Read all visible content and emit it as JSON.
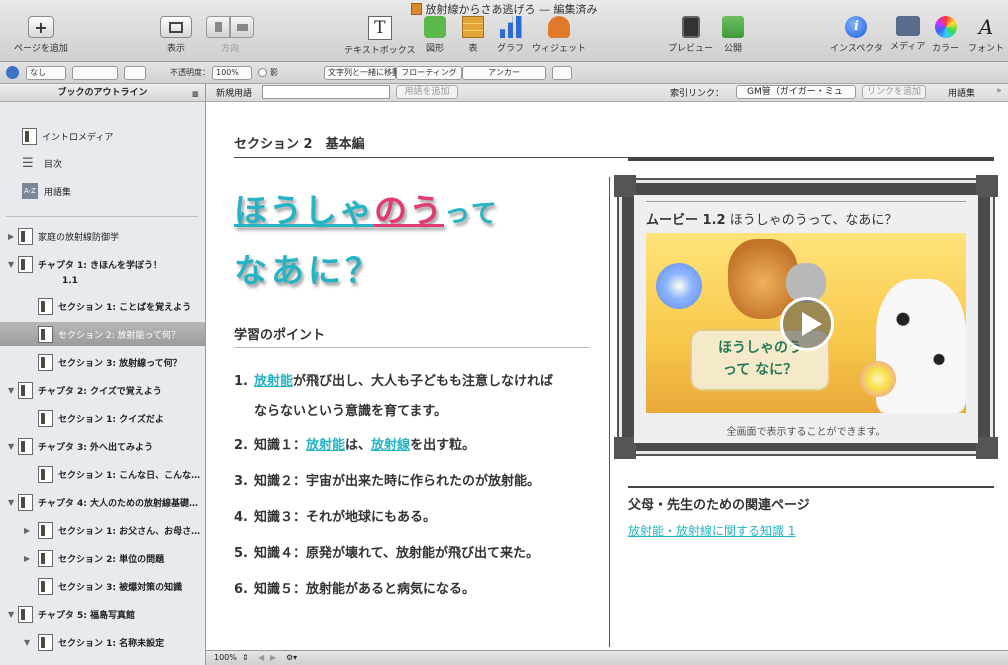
{
  "window": {
    "title": "放射線からさあ逃げろ — 編集済み"
  },
  "toolbar": {
    "add_page": "ページを追加",
    "view": "表示",
    "orientation": "方向",
    "textbox": "テキストボックス",
    "shape": "図形",
    "table": "表",
    "chart": "グラフ",
    "widget": "ウィジェット",
    "preview": "プレビュー",
    "publish": "公開",
    "inspector": "インスペクタ",
    "media": "メディア",
    "colors": "カラー",
    "fonts": "フォント"
  },
  "formatbar": {
    "style": "なし",
    "opacity_label": "不透明度：",
    "opacity_value": "100%",
    "shadow_label": "影",
    "move_with_text": "文字列と一緒に移動",
    "floating": "フローティング",
    "anchor": "アンカー"
  },
  "glossbar": {
    "new_term_label": "新規用語",
    "new_term_value": "",
    "add_term_button": "用語を追加",
    "index_link_label": "索引リンク：",
    "index_link_value": "GM管（ガイガー・ミュ",
    "add_link_button": "リンクを追加",
    "glossary_button": "用語集"
  },
  "sidebar": {
    "header": "ブックのアウトライン",
    "front": [
      {
        "label": "イントロメディア"
      },
      {
        "label": "目次"
      },
      {
        "label": "用語集",
        "icon": "A-Z"
      }
    ],
    "items": [
      {
        "label": "家庭の放射線防御学"
      },
      {
        "label": "チャプタ 1: きほんを学ぼう！"
      },
      {
        "label": "1.1"
      },
      {
        "label": "セクション 1: ことばを覚えよう"
      },
      {
        "label": "セクション 2: 放射能って何？"
      },
      {
        "label": "セクション 3: 放射線って何？"
      },
      {
        "label": "チャプタ 2: クイズで覚えよう"
      },
      {
        "label": "セクション 1: クイズだよ"
      },
      {
        "label": "チャプタ 3: 外へ出てみよう"
      },
      {
        "label": "セクション 1: こんな日、こんな…"
      },
      {
        "label": "チャプタ 4: 大人のための放射線基礎…"
      },
      {
        "label": "セクション 1: お父さん、お母さ…"
      },
      {
        "label": "セクション 2: 単位の問題"
      },
      {
        "label": "セクション 3: 被爆対策の知識"
      },
      {
        "label": "チャプタ 5: 福島写真館"
      },
      {
        "label": "セクション 1: 名称未設定"
      }
    ]
  },
  "page": {
    "section_title": "セクション 2　基本編",
    "heading_line1": {
      "a": "ほうしゃ",
      "b": "のう",
      "c": "って"
    },
    "heading_line2": "なあに？",
    "points_title": "学習のポイント",
    "points": [
      {
        "num": "1.",
        "link": "放射能",
        "text": "が飛び出し、大人も子どもも注意しなければ"
      },
      {
        "num": "",
        "text": "ならないという意識を育てます。"
      },
      {
        "num": "2.",
        "pre": "知識１：",
        "link": "放射能",
        "mid": "は、",
        "link2": "放射線",
        "text": "を出す粒。"
      },
      {
        "num": "3.",
        "text": "知識２：宇宙が出来た時に作られたのが放射能。"
      },
      {
        "num": "4.",
        "text": "知識３：それが地球にもある。"
      },
      {
        "num": "5.",
        "text": "知識４：原発が壊れて、放射能が飛び出て来た。"
      },
      {
        "num": "6.",
        "text": "知識５：放射能があると病気になる。"
      }
    ],
    "movie": {
      "label": "ムービー 1.2",
      "title": "ほうしゃのうって、なあに？",
      "image_text1": "ほうしゃのう",
      "image_text2": "って なに？",
      "caption": "全画面で表示することができます。"
    },
    "related_title": "父母・先生のための関連ページ",
    "related_link": "放射能・放射線に関する知識 1"
  },
  "status": {
    "zoom": "100%"
  }
}
